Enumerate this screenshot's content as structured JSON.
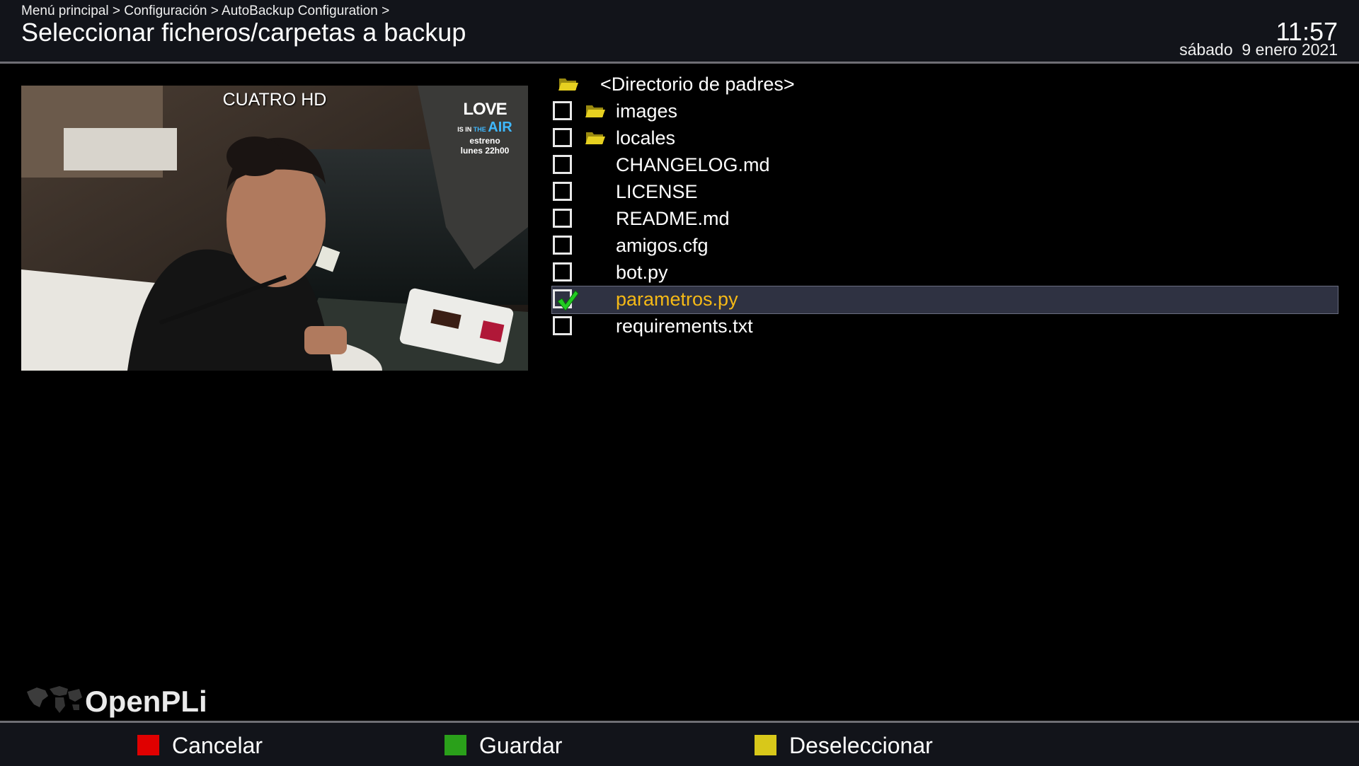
{
  "header": {
    "breadcrumb": "Menú principal > Configuración > AutoBackup Configuration >",
    "title": "Seleccionar ficheros/carpetas a backup",
    "clock": "11:57",
    "date": "sábado  9 enero 2021"
  },
  "tv_preview": {
    "channel": "CUATRO HD",
    "promo_love": "LOVE",
    "promo_isin": "IS IN",
    "promo_the": "THE",
    "promo_air": "AIR",
    "promo_line1": "estreno",
    "promo_line2": "lunes 22h00"
  },
  "file_list": {
    "parent": "<Directorio de padres>",
    "items": [
      {
        "label": "images",
        "type": "folder",
        "checked": false
      },
      {
        "label": "locales",
        "type": "folder",
        "checked": false
      },
      {
        "label": "CHANGELOG.md",
        "type": "file",
        "checked": false
      },
      {
        "label": "LICENSE",
        "type": "file",
        "checked": false
      },
      {
        "label": "README.md",
        "type": "file",
        "checked": false
      },
      {
        "label": "amigos.cfg",
        "type": "file",
        "checked": false
      },
      {
        "label": "bot.py",
        "type": "file",
        "checked": false
      },
      {
        "label": "parametros.py",
        "type": "file",
        "checked": true,
        "selected": true
      },
      {
        "label": "requirements.txt",
        "type": "file",
        "checked": false
      }
    ]
  },
  "brand": {
    "name": "OpenPLi"
  },
  "footer": {
    "red_label": "Cancelar",
    "green_label": "Guardar",
    "yellow_label": "Deseleccionar"
  },
  "colors": {
    "red": "#e00000",
    "green": "#2aa01a",
    "yellow": "#d8c81a",
    "selection_text": "#f5b916",
    "check": "#22cc22"
  }
}
